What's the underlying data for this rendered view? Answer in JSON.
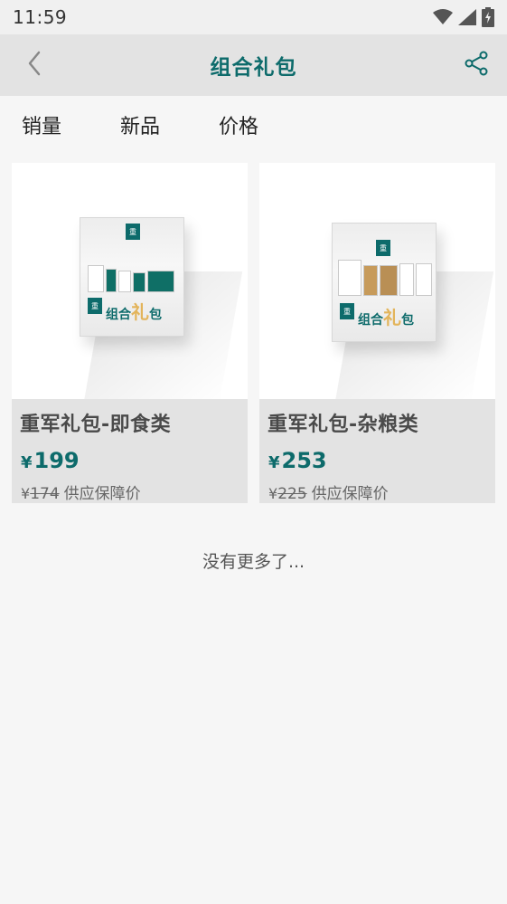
{
  "status": {
    "time": "11:59"
  },
  "header": {
    "title": "组合礼包"
  },
  "sort_tabs": [
    "销量",
    "新品",
    "价格"
  ],
  "products": [
    {
      "name": "重军礼包-即食类",
      "currency": "¥",
      "price": "199",
      "original_price": "174",
      "original_label": "供应保障价"
    },
    {
      "name": "重军礼包-杂粮类",
      "currency": "¥",
      "price": "253",
      "original_price": "225",
      "original_label": "供应保障价"
    }
  ],
  "footer": {
    "no_more": "没有更多了..."
  },
  "colors": {
    "accent": "#0d6b6b",
    "header_bg": "#e3e3e3",
    "page_bg": "#f6f6f6"
  }
}
